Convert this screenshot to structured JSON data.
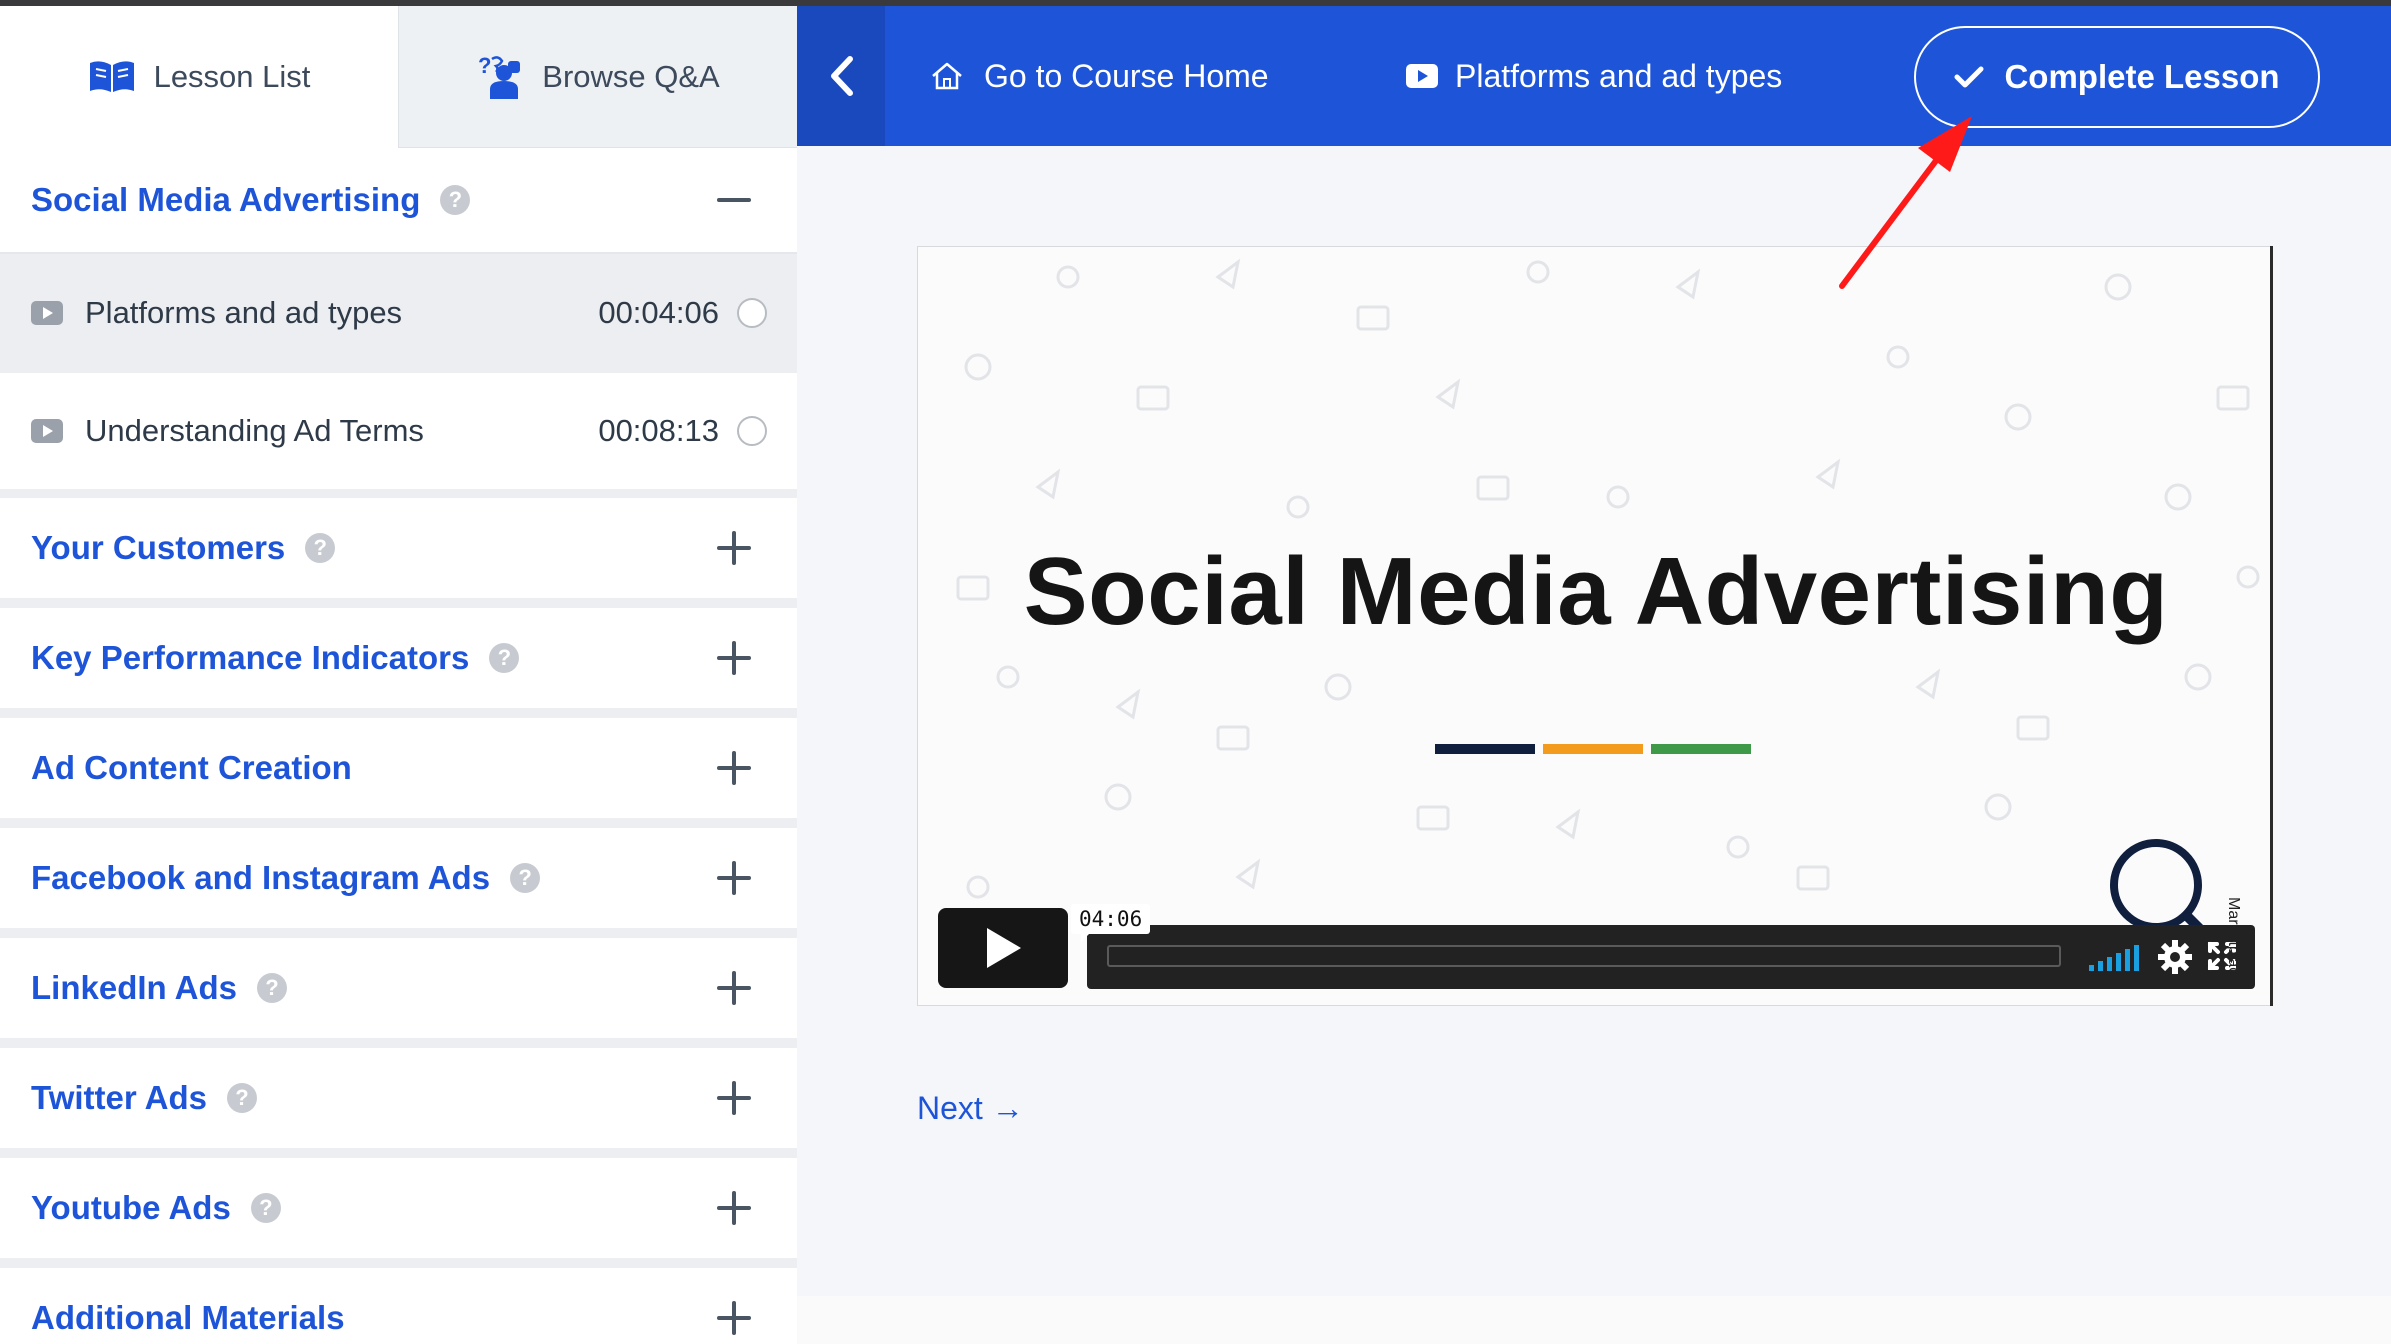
{
  "sidebar": {
    "tabs": [
      {
        "label": "Lesson List",
        "icon": "book-icon"
      },
      {
        "label": "Browse Q&A",
        "icon": "qa-icon"
      }
    ],
    "sections": [
      {
        "title": "Social Media Advertising",
        "has_help": true,
        "expanded": true
      },
      {
        "title": "Your Customers",
        "has_help": true,
        "expanded": false
      },
      {
        "title": "Key Performance Indicators",
        "has_help": true,
        "expanded": false
      },
      {
        "title": "Ad Content Creation",
        "has_help": false,
        "expanded": false
      },
      {
        "title": "Facebook and Instagram Ads",
        "has_help": true,
        "expanded": false
      },
      {
        "title": "LinkedIn Ads",
        "has_help": true,
        "expanded": false
      },
      {
        "title": "Twitter Ads",
        "has_help": true,
        "expanded": false
      },
      {
        "title": "Youtube Ads",
        "has_help": true,
        "expanded": false
      },
      {
        "title": "Additional Materials",
        "has_help": false,
        "expanded": false
      }
    ],
    "lessons": [
      {
        "title": "Platforms and ad types",
        "duration": "00:04:06",
        "current": true
      },
      {
        "title": "Understanding Ad Terms",
        "duration": "00:08:13",
        "current": false
      }
    ],
    "help_glyph": "?"
  },
  "navbar": {
    "home_label": "Go to Course Home",
    "lesson_label": "Platforms and ad types",
    "complete_label": "Complete Lesson"
  },
  "video": {
    "title": "Social Media Advertising",
    "time_tooltip": "04:06",
    "watermark": "Marketplace",
    "bar_colors": [
      "#0f1f3d",
      "#f29b1d",
      "#3e9a48"
    ]
  },
  "next_label": "Next →",
  "colors": {
    "accent": "#1e55d8",
    "accent_dark": "#1a48bd",
    "annotation": "#ff1a1a"
  }
}
